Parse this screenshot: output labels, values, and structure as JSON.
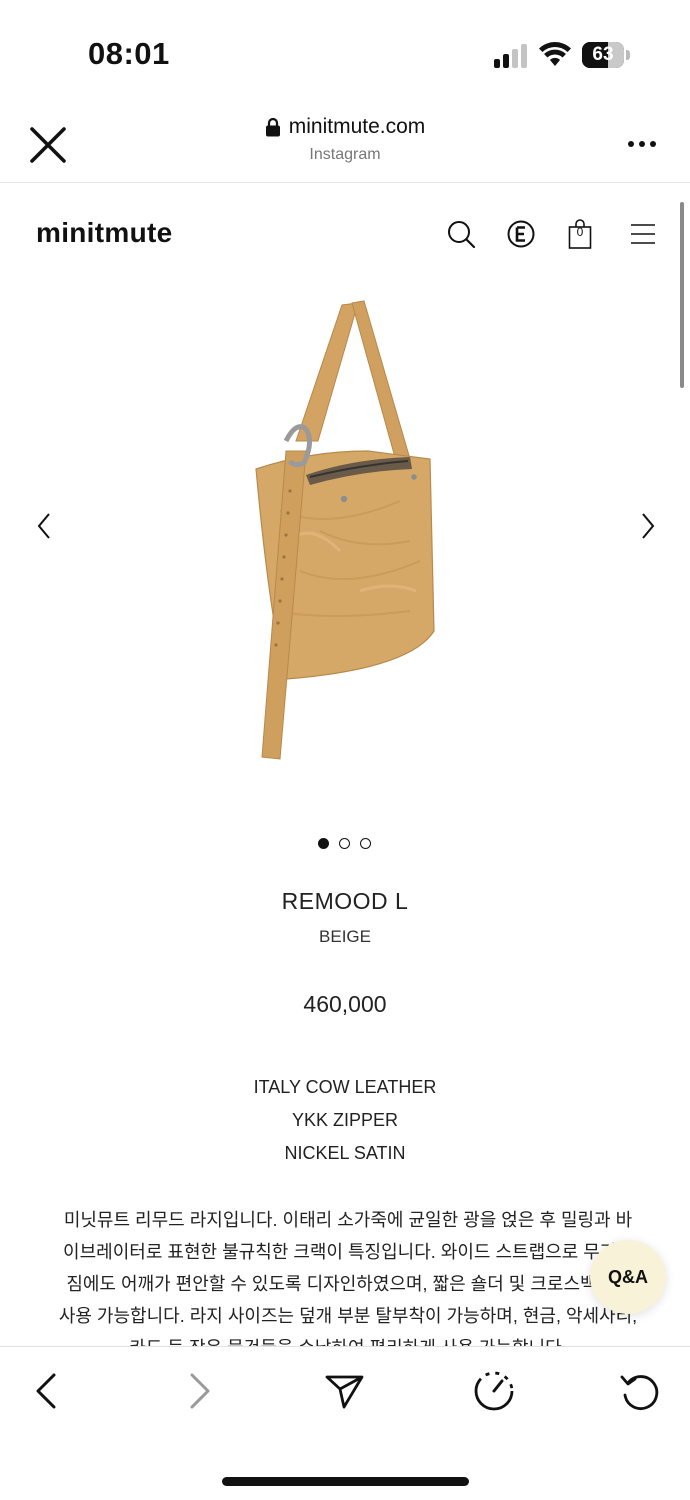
{
  "status_bar": {
    "time": "08:01",
    "battery": "63",
    "battery_level": 0.63
  },
  "browser": {
    "domain": "minitmute.com",
    "source": "Instagram"
  },
  "site": {
    "logo": "minitmute",
    "cart_count": "0",
    "icons": [
      "search-icon",
      "e-currency-icon",
      "shopping-bag-icon",
      "menu-icon"
    ]
  },
  "gallery": {
    "slide_count": 3,
    "active_slide": 1
  },
  "product": {
    "name": "REMOOD L",
    "color": "BEIGE",
    "price": "460,000",
    "specs": [
      "ITALY COW LEATHER",
      "YKK ZIPPER",
      "NICKEL SATIN"
    ],
    "description": "미닛뮤트 리무드 라지입니다. 이태리 소가죽에 균일한 광을 얹은 후 밀링과 바이브레이터로 표현한 불규칙한 크랙이 특징입니다. 와이드 스트랩으로 무거운 짐에도 어깨가 편안할 수 있도록 디자인하였으며, 짧은 숄더 및 크로스백으로 사용 가능합니다. 라지 사이즈는 덮개 부분 탈부착이 가능하며, 현금, 악세사리, 카드 등 작은 물건들을 수납하여 편리하게 사용 가능합니다."
  },
  "qa_button": "Q&A",
  "colors": {
    "qa_background": "#f8f2d8",
    "bag_leather": "#d6a868"
  }
}
